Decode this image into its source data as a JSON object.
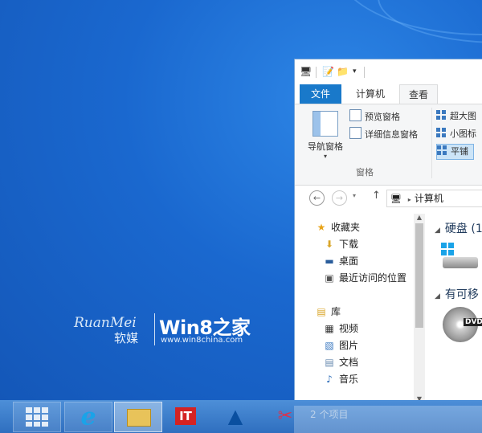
{
  "watermark": {
    "ruanmei": "RuanMei",
    "ruanmei_cn": "软媒",
    "brand": "Win8之家",
    "url": "www.win8china.com"
  },
  "ribbon": {
    "tabs": [
      {
        "label": "文件"
      },
      {
        "label": "计算机"
      },
      {
        "label": "查看"
      }
    ],
    "nav_pane": "导航窗格",
    "preview_pane": "预览窗格",
    "details_pane": "详细信息窗格",
    "group_label": "窗格",
    "layout_items": [
      "超大图",
      "小图标",
      "平铺"
    ]
  },
  "address": {
    "path": "计算机"
  },
  "nav": {
    "favorites": "收藏夹",
    "downloads": "下载",
    "desktop": "桌面",
    "recent": "最近访问的位置",
    "libraries": "库",
    "videos": "视频",
    "pictures": "图片",
    "documents": "文档",
    "music": "音乐"
  },
  "content": {
    "hard_drives": "硬盘 (1",
    "removable": "有可移",
    "dvd": "DVD"
  },
  "status": {
    "items": "2 个项目"
  },
  "taskbar": {
    "ie_glyph": "e",
    "it_label": "IT"
  }
}
